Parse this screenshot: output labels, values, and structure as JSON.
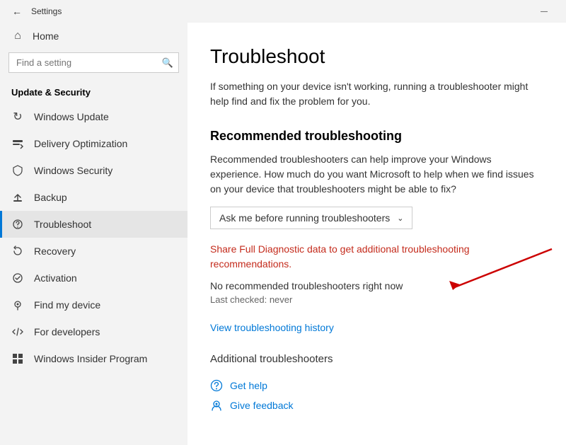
{
  "titlebar": {
    "title": "Settings",
    "minimize_label": "—"
  },
  "sidebar": {
    "home_label": "Home",
    "search_placeholder": "Find a setting",
    "section_title": "Update & Security",
    "items": [
      {
        "id": "windows-update",
        "label": "Windows Update",
        "icon": "↻"
      },
      {
        "id": "delivery-optimization",
        "label": "Delivery Optimization",
        "icon": "⬇"
      },
      {
        "id": "windows-security",
        "label": "Windows Security",
        "icon": "🛡"
      },
      {
        "id": "backup",
        "label": "Backup",
        "icon": "↑"
      },
      {
        "id": "troubleshoot",
        "label": "Troubleshoot",
        "icon": "⚙"
      },
      {
        "id": "recovery",
        "label": "Recovery",
        "icon": "↩"
      },
      {
        "id": "activation",
        "label": "Activation",
        "icon": "✓"
      },
      {
        "id": "find-my-device",
        "label": "Find my device",
        "icon": "⊙"
      },
      {
        "id": "for-developers",
        "label": "For developers",
        "icon": "{ }"
      },
      {
        "id": "windows-insider",
        "label": "Windows Insider Program",
        "icon": "◈"
      }
    ]
  },
  "content": {
    "title": "Troubleshoot",
    "intro": "If something on your device isn't working, running a troubleshooter might help find and fix the problem for you.",
    "recommended_heading": "Recommended troubleshooting",
    "recommended_desc": "Recommended troubleshooters can help improve your Windows experience. How much do you want Microsoft to help when we find issues on your device that troubleshooters might be able to fix?",
    "dropdown_label": "Ask me before running troubleshooters",
    "share_link": "Share Full Diagnostic data to get additional troubleshooting recommendations.",
    "no_troubleshooters": "No recommended troubleshooters right now",
    "last_checked": "Last checked: never",
    "view_history_link": "View troubleshooting history",
    "additional_heading": "Additional troubleshooters",
    "get_help_label": "Get help",
    "give_feedback_label": "Give feedback"
  }
}
